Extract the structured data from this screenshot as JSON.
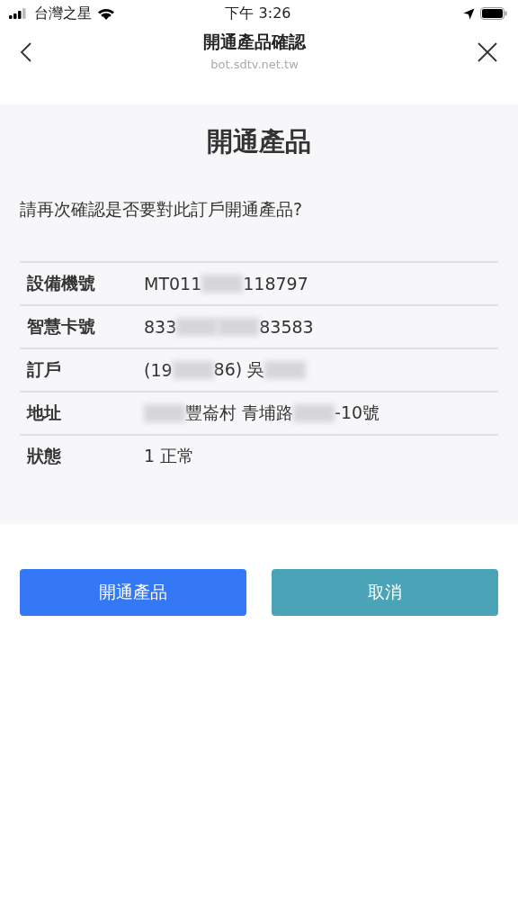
{
  "status_bar": {
    "carrier": "台灣之星",
    "time": "下午 3:26"
  },
  "header": {
    "title": "開通產品確認",
    "url": "bot.sdtv.net.tw"
  },
  "panel": {
    "title": "開通產品",
    "question": "請再次確認是否要對此訂戶開通產品?",
    "rows": [
      {
        "label": "設備機號",
        "value": [
          {
            "kind": "text",
            "text": "MT011"
          },
          {
            "kind": "redacted"
          },
          {
            "kind": "text",
            "text": "118797"
          }
        ]
      },
      {
        "label": "智慧卡號",
        "value": [
          {
            "kind": "text",
            "text": "833"
          },
          {
            "kind": "redacted"
          },
          {
            "kind": "redacted"
          },
          {
            "kind": "text",
            "text": "83583"
          }
        ]
      },
      {
        "label": "訂戶",
        "value": [
          {
            "kind": "text",
            "text": "(19"
          },
          {
            "kind": "redacted"
          },
          {
            "kind": "text",
            "text": "86) 吳"
          },
          {
            "kind": "redacted"
          }
        ]
      },
      {
        "label": "地址",
        "value": [
          {
            "kind": "redacted"
          },
          {
            "kind": "text",
            "text": "豐崙村 青埔路"
          },
          {
            "kind": "redacted"
          },
          {
            "kind": "text",
            "text": "-10號"
          }
        ]
      },
      {
        "label": "狀態",
        "value": [
          {
            "kind": "text",
            "text": "1 正常"
          }
        ]
      }
    ]
  },
  "buttons": [
    {
      "label": "開通產品",
      "kind": "primary"
    },
    {
      "label": "取消",
      "kind": "secondary"
    }
  ]
}
